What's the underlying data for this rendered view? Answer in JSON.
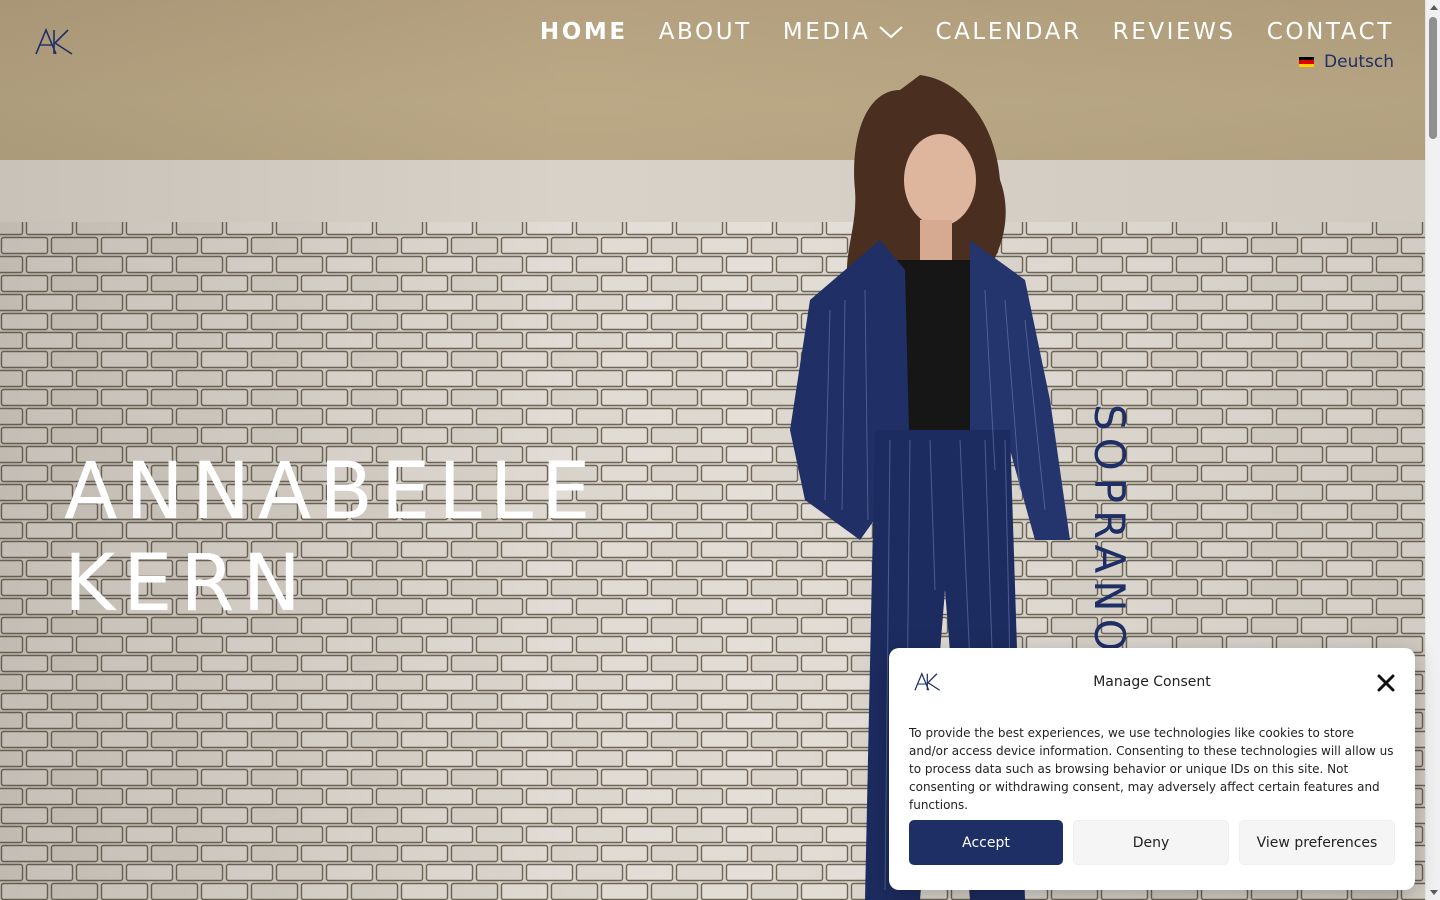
{
  "colors": {
    "brand_navy": "#1e2f66",
    "nav_text": "#ffffff",
    "accept_bg": "#1e2f66",
    "secondary_btn_bg": "#f5f5f5"
  },
  "logo": {
    "text": "AK",
    "icon": "ak-monogram-logo"
  },
  "nav": {
    "items": [
      {
        "label": "HOME",
        "active": true
      },
      {
        "label": "ABOUT"
      },
      {
        "label": "MEDIA",
        "has_dropdown": true
      },
      {
        "label": "CALENDAR"
      },
      {
        "label": "REVIEWS"
      },
      {
        "label": "CONTACT"
      }
    ],
    "language": {
      "label": "Deutsch",
      "icon": "german-flag-icon"
    }
  },
  "hero": {
    "name_line1": "ANNABELLE",
    "name_line2": "KERN",
    "voice_type": "SOPRANO"
  },
  "consent": {
    "title": "Manage Consent",
    "body": "To provide the best experiences, we use technologies like cookies to store and/or access device information. Consenting to these technologies will allow us to process data such as browsing behavior or unique IDs on this site. Not consenting or withdrawing consent, may adversely affect certain features and functions.",
    "buttons": {
      "accept": "Accept",
      "deny": "Deny",
      "preferences": "View preferences"
    }
  }
}
